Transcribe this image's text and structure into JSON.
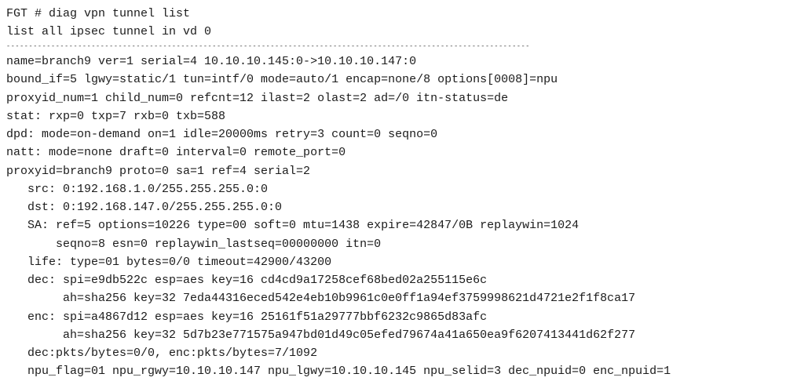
{
  "prompt": "FGT # diag vpn tunnel list",
  "subtitle": "list all ipsec tunnel in vd 0",
  "separator": "---------------------------------------------------------------------------------------------------------------------",
  "line_name": "name=branch9 ver=1 serial=4 10.10.10.145:0->10.10.10.147:0",
  "line_bound": "bound_if=5 lgwy=static/1 tun=intf/0 mode=auto/1 encap=none/8 options[0008]=npu",
  "line_proxynum": "proxyid_num=1 child_num=0 refcnt=12 ilast=2 olast=2 ad=/0 itn-status=de",
  "line_stat": "stat: rxp=0 txp=7 rxb=0 txb=588",
  "line_dpd": "dpd: mode=on-demand on=1 idle=20000ms retry=3 count=0 seqno=0",
  "line_natt": "natt: mode=none draft=0 interval=0 remote_port=0",
  "line_proxyid": "proxyid=branch9 proto=0 sa=1 ref=4 serial=2",
  "line_src": "   src: 0:192.168.1.0/255.255.255.0:0",
  "line_dst": "   dst: 0:192.168.147.0/255.255.255.0:0",
  "line_sa": "   SA: ref=5 options=10226 type=00 soft=0 mtu=1438 expire=42847/0B replaywin=1024",
  "line_seqno": "       seqno=8 esn=0 replaywin_lastseq=00000000 itn=0",
  "line_life": "   life: type=01 bytes=0/0 timeout=42900/43200",
  "line_dec": "   dec: spi=e9db522c esp=aes key=16 cd4cd9a17258cef68bed02a255115e6c",
  "line_dec_ah": "        ah=sha256 key=32 7eda44316eced542e4eb10b9961c0e0ff1a94ef3759998621d4721e2f1f8ca17",
  "line_enc": "   enc: spi=a4867d12 esp=aes key=16 25161f51a29777bbf6232c9865d83afc",
  "line_enc_ah": "        ah=sha256 key=32 5d7b23e771575a947bd01d49c05efed79674a41a650ea9f6207413441d62f277",
  "line_pkts": "   dec:pkts/bytes=0/0, enc:pkts/bytes=7/1092",
  "line_npu": "   npu_flag=01 npu_rgwy=10.10.10.147 npu_lgwy=10.10.10.145 npu_selid=3 dec_npuid=0 enc_npuid=1"
}
